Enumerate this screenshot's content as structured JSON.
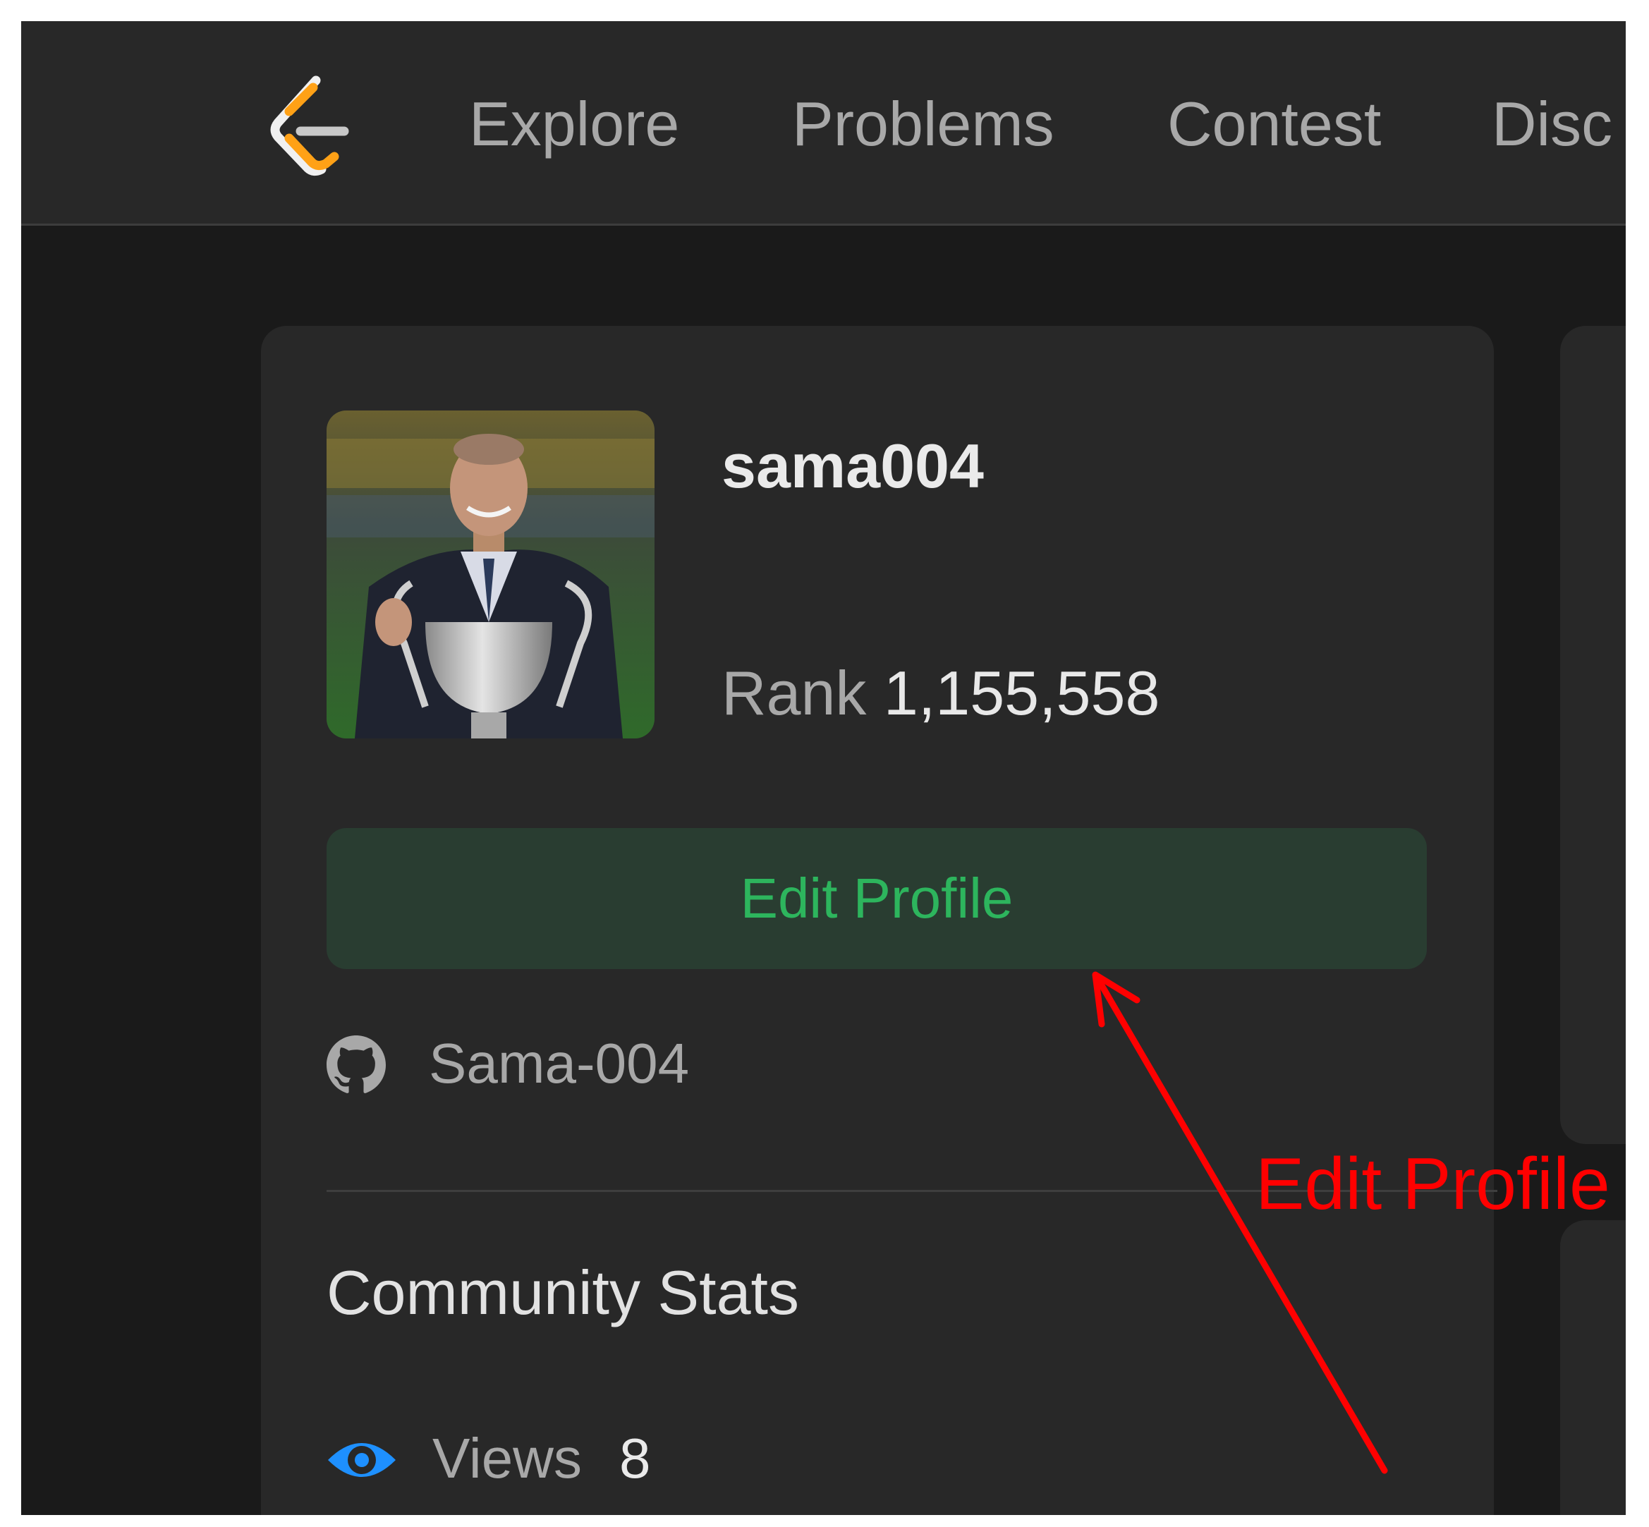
{
  "nav": {
    "items": [
      {
        "label": "Explore"
      },
      {
        "label": "Problems"
      },
      {
        "label": "Contest"
      },
      {
        "label": "Disc"
      }
    ]
  },
  "profile": {
    "username": "sama004",
    "rank_label": "Rank",
    "rank_value": "1,155,558",
    "edit_button_label": "Edit Profile",
    "github": "Sama-004"
  },
  "community_stats": {
    "title": "Community Stats",
    "views_label": "Views",
    "views_value": "8"
  },
  "annotation": {
    "text": "Edit Profile",
    "color": "#ff0000"
  },
  "colors": {
    "accent_green": "#2db55d",
    "button_bg": "#293d31",
    "page_bg": "#1a1a1a",
    "card_bg": "#282828",
    "logo_orange": "#ffa116",
    "views_icon_blue": "#1e90ff"
  },
  "icons": [
    "leetcode-logo",
    "github-icon",
    "eye-icon",
    "arrow-annotation"
  ]
}
